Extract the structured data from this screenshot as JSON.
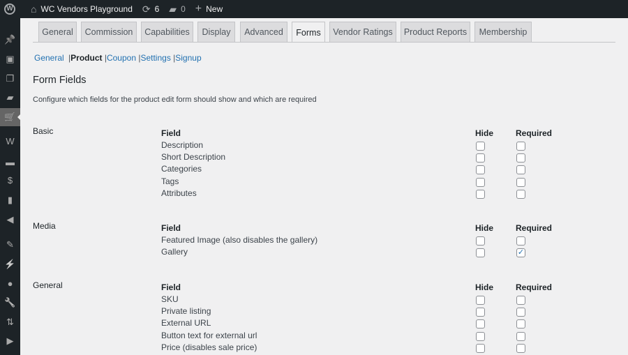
{
  "adminbar": {
    "site": "WC Vendors Playground",
    "updates": "6",
    "comments": "0",
    "new": "New"
  },
  "sidebar": [
    "pin-icon",
    "media-icon",
    "pages-icon",
    "comments-icon",
    "cart-icon",
    "woo-icon",
    "archive-icon",
    "money-icon",
    "chart-icon",
    "megaphone-icon",
    "brush-icon",
    "plugin-icon",
    "user-icon",
    "wrench-icon",
    "settings-icon",
    "play-icon"
  ],
  "tabs": [
    "General",
    "Commission",
    "Capabilities",
    "Display",
    "Advanced",
    "Forms",
    "Vendor Ratings",
    "Product Reports",
    "Membership"
  ],
  "active_tab": "Forms",
  "subnav": [
    "General",
    "Product",
    "Coupon",
    "Settings",
    "Signup"
  ],
  "title": "Form Fields",
  "description": "Configure which fields for the product edit form should show and which are required",
  "headers": {
    "field": "Field",
    "hide": "Hide",
    "required": "Required"
  },
  "sections": [
    {
      "name": "Basic",
      "fields": [
        {
          "label": "Description",
          "hide": false,
          "required": false
        },
        {
          "label": "Short Description",
          "hide": false,
          "required": false
        },
        {
          "label": "Categories",
          "hide": false,
          "required": false
        },
        {
          "label": "Tags",
          "hide": false,
          "required": false
        },
        {
          "label": "Attributes",
          "hide": false,
          "required": false
        }
      ]
    },
    {
      "name": "Media",
      "fields": [
        {
          "label": "Featured Image (also disables the gallery)",
          "hide": false,
          "required": false
        },
        {
          "label": "Gallery",
          "hide": false,
          "required": true
        }
      ]
    },
    {
      "name": "General",
      "fields": [
        {
          "label": "SKU",
          "hide": false,
          "required": false
        },
        {
          "label": "Private listing",
          "hide": false,
          "required": false
        },
        {
          "label": "External URL",
          "hide": false,
          "required": false
        },
        {
          "label": "Button text for external url",
          "hide": false,
          "required": false
        },
        {
          "label": "Price (disables sale price)",
          "hide": false,
          "required": false
        }
      ]
    }
  ]
}
